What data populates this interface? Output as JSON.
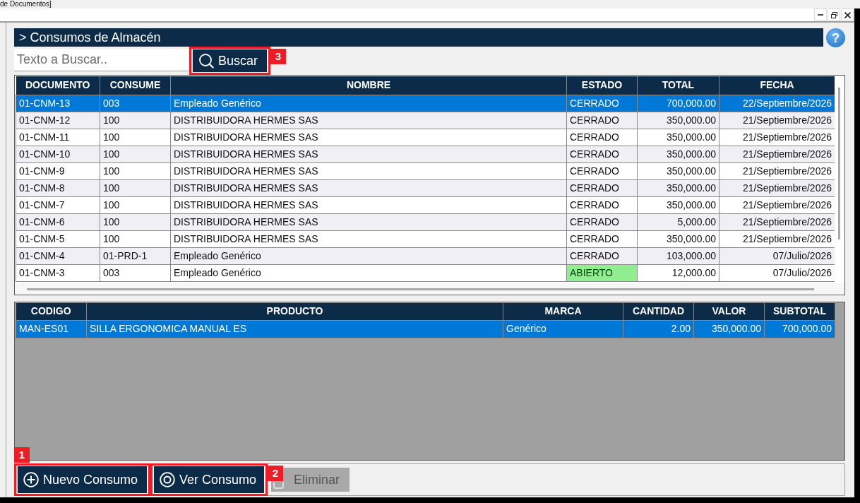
{
  "window": {
    "title": "de Documentos]"
  },
  "header": {
    "title": "> Consumos de Almacén",
    "help": "?"
  },
  "search": {
    "placeholder": "Texto a Buscar..",
    "button": {
      "label": "Buscar",
      "callout": {
        "number": "3",
        "kind": "beside"
      }
    }
  },
  "documents": {
    "columns": [
      {
        "label": "DOCUMENTO",
        "kind": "text"
      },
      {
        "label": "CONSUME",
        "kind": "text"
      },
      {
        "label": "NOMBRE",
        "kind": "text"
      },
      {
        "label": "ESTADO",
        "kind": "status"
      },
      {
        "label": "TOTAL",
        "kind": "number"
      },
      {
        "label": "FECHA",
        "kind": "date"
      }
    ],
    "rows": [
      {
        "cells": [
          "01-CNM-13",
          "003",
          "Empleado Genérico",
          "CERRADO",
          "700,000.00",
          "22/Septiembre/2026"
        ],
        "selected": true
      },
      {
        "cells": [
          "01-CNM-12",
          "100",
          "DISTRIBUIDORA HERMES SAS",
          "CERRADO",
          "350,000.00",
          "21/Septiembre/2026"
        ],
        "selected": false
      },
      {
        "cells": [
          "01-CNM-11",
          "100",
          "DISTRIBUIDORA HERMES SAS",
          "CERRADO",
          "350,000.00",
          "21/Septiembre/2026"
        ],
        "selected": false
      },
      {
        "cells": [
          "01-CNM-10",
          "100",
          "DISTRIBUIDORA HERMES SAS",
          "CERRADO",
          "350,000.00",
          "21/Septiembre/2026"
        ],
        "selected": false
      },
      {
        "cells": [
          "01-CNM-9",
          "100",
          "DISTRIBUIDORA HERMES SAS",
          "CERRADO",
          "350,000.00",
          "21/Septiembre/2026"
        ],
        "selected": false
      },
      {
        "cells": [
          "01-CNM-8",
          "100",
          "DISTRIBUIDORA HERMES SAS",
          "CERRADO",
          "350,000.00",
          "21/Septiembre/2026"
        ],
        "selected": false
      },
      {
        "cells": [
          "01-CNM-7",
          "100",
          "DISTRIBUIDORA HERMES SAS",
          "CERRADO",
          "350,000.00",
          "21/Septiembre/2026"
        ],
        "selected": false
      },
      {
        "cells": [
          "01-CNM-6",
          "100",
          "DISTRIBUIDORA HERMES SAS",
          "CERRADO",
          "5,000.00",
          "21/Septiembre/2026"
        ],
        "selected": false
      },
      {
        "cells": [
          "01-CNM-5",
          "100",
          "DISTRIBUIDORA HERMES SAS",
          "CERRADO",
          "350,000.00",
          "21/Septiembre/2026"
        ],
        "selected": false
      },
      {
        "cells": [
          "01-CNM-4",
          "01-PRD-1",
          "Empleado Genérico",
          "CERRADO",
          "103,000.00",
          "07/Julio/2026"
        ],
        "selected": false
      },
      {
        "cells": [
          "01-CNM-3",
          "003",
          "Empleado Genérico",
          "ABIERTO",
          "12,000.00",
          "07/Julio/2026"
        ],
        "selected": false,
        "color": "#90ee90"
      }
    ]
  },
  "details": {
    "columns": [
      {
        "label": "CODIGO",
        "kind": "text"
      },
      {
        "label": "PRODUCTO",
        "kind": "text"
      },
      {
        "label": "MARCA",
        "kind": "text"
      },
      {
        "label": "CANTIDAD",
        "kind": "number"
      },
      {
        "label": "VALOR",
        "kind": "number"
      },
      {
        "label": "SUBTOTAL",
        "kind": "number"
      }
    ],
    "rows": [
      {
        "cells": [
          "MAN-ES01",
          "SILLA ERGONOMICA MANUAL ES",
          "Genérico",
          "2.00",
          "350,000.00",
          "700,000.00"
        ],
        "selected": true
      }
    ]
  },
  "actions": [
    {
      "label": "Nuevo Consumo",
      "kind": "add",
      "disabled": false,
      "callout": {
        "number": "1",
        "kind": "above"
      }
    },
    {
      "label": "Ver Consumo",
      "kind": "view",
      "disabled": false,
      "callout": {
        "number": "2",
        "kind": "beside"
      }
    },
    {
      "label": "Eliminar",
      "kind": "delete",
      "disabled": true
    }
  ]
}
